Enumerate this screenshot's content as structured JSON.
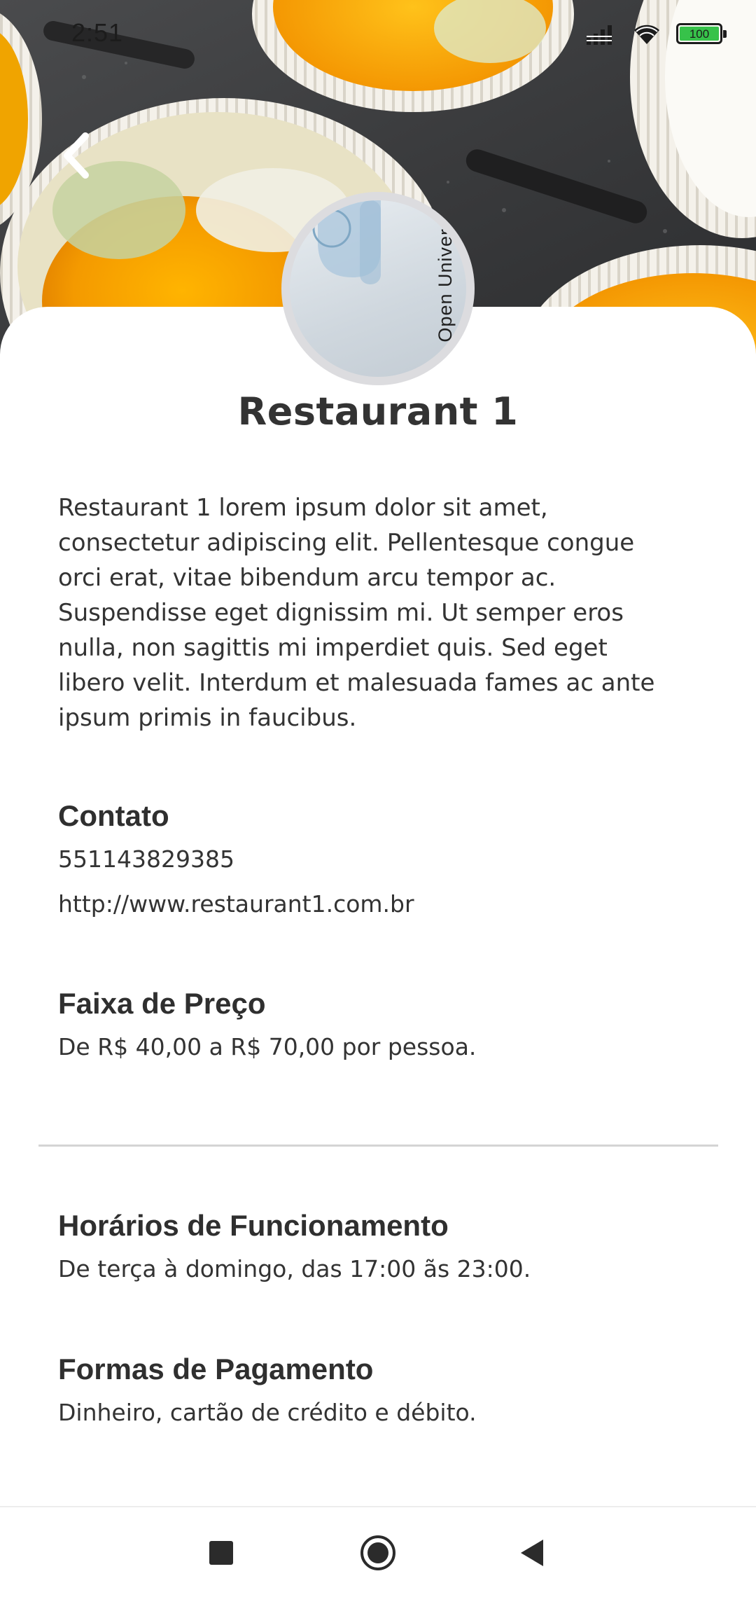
{
  "status_bar": {
    "time": "2:51",
    "battery_level": "100",
    "battery_color": "#37c24a"
  },
  "header": {
    "back_icon": "chevron-left-icon"
  },
  "avatar": {
    "caption": "Open Univer"
  },
  "restaurant": {
    "name": "Restaurant 1",
    "description_lines": [
      "Restaurant 1 lorem ipsum dolor sit amet,",
      "consectetur adipiscing elit. Pellentesque congue",
      "orci erat, vitae bibendum arcu tempor ac.",
      "Suspendisse eget dignissim mi. Ut semper eros",
      "nulla, non sagittis mi imperdiet quis. Sed eget",
      "libero velit. Interdum et malesuada fames ac ante",
      "ipsum primis in faucibus."
    ]
  },
  "contact": {
    "title": "Contato",
    "phone": "551143829385",
    "website": "http://www.restaurant1.com.br"
  },
  "price_range": {
    "title": "Faixa de Preço",
    "text": "De R$ 40,00 a R$ 70,00 por pessoa."
  },
  "hours": {
    "title": "Horários de Funcionamento",
    "text": "De terça à domingo, das 17:00 ãs 23:00."
  },
  "payment": {
    "title": "Formas de Pagamento",
    "text": "Dinheiro, cartão de crédito e débito."
  },
  "nav_bar": {
    "recents_icon": "square-icon",
    "home_icon": "circle-icon",
    "back_icon": "triangle-back-icon"
  }
}
